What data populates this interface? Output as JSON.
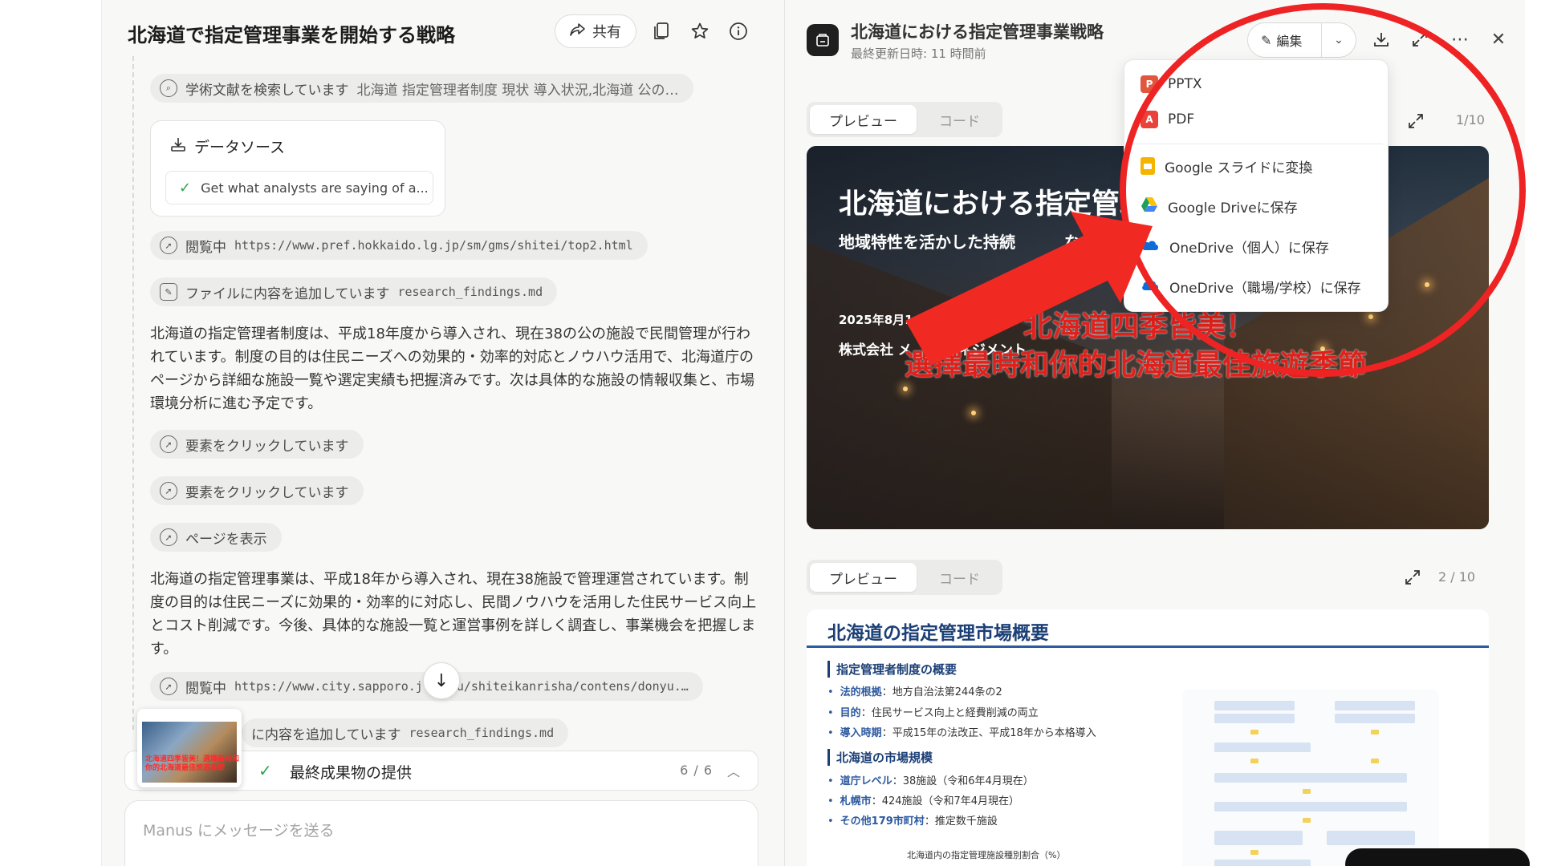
{
  "chat": {
    "title": "北海道で指定管理事業を開始する戦略",
    "share_label": "共有",
    "steps": {
      "search_academic": {
        "label": "学術文献を検索しています",
        "query": "北海道 指定管理者制度 現状 導入状況,北海道 公の…"
      },
      "browsing_1": {
        "label": "閲覧中",
        "url": "https://www.pref.hokkaido.lg.jp/sm/gms/shitei/top2.html"
      },
      "add_file_1": {
        "label": "ファイルに内容を追加しています",
        "file": "research_findings.md"
      },
      "click_1": {
        "label": "要素をクリックしています"
      },
      "click_2": {
        "label": "要素をクリックしています"
      },
      "view_page": {
        "label": "ページを表示"
      },
      "browsing_2": {
        "label": "閲覧中",
        "url_start": "https://www.city.sapporo.j",
        "url_end": "u/shiteikanrisha/contens/donyu.…"
      },
      "add_file_2": {
        "label": "に内容を追加しています",
        "file": "research_findings.md"
      }
    },
    "datasource": {
      "title": "データソース",
      "item": "Get what analysts are saying of a..."
    },
    "paragraph_1": "北海道の指定管理者制度は、平成18年度から導入され、現在38の公の施設で民間管理が行われています。制度の目的は住民ニーズへの効果的・効率的対応とノウハウ活用で、北海道庁のページから詳細な施設一覧や選定実績も把握済みです。次は具体的な施設の情報収集と、市場環境分析に進む予定です。",
    "paragraph_2": "北海道の指定管理事業は、平成18年から導入され、現在38施設で管理運営されています。制度の目的は住民ニーズに効果的・効率的に対応し、民間ノウハウを活用した住民サービス向上とコスト削減です。今後、具体的な施設一覧と運営事例を詳しく調査し、事業機会を把握します。",
    "progress": {
      "label": "最終成果物の提供",
      "count": "6 / 6"
    },
    "thumbnail_text": "北海道四季皆美！選擇最時和你的北海道最佳旅遊季節",
    "message_placeholder": "Manus にメッセージを送る"
  },
  "preview": {
    "title": "北海道における指定管理事業戦略",
    "subtitle": "最終更新日時: 11 時間前",
    "edit_label": "編集",
    "tab_preview": "プレビュー",
    "tab_code": "コード",
    "slide1_count": "1/10",
    "slide2_count": "2 / 10",
    "slide1": {
      "title": "北海道における指定管理事",
      "subtitle": "地域特性を活かした持続",
      "subtitle_tail": "な公共施",
      "date": "2025年8月1",
      "company": "株式会社 メ",
      "company_tail": "ンマネジメント",
      "watermark_line1": "北海道四季皆美！",
      "watermark_line2": "選擇最時和你的北海道最佳旅遊季節"
    },
    "slide2": {
      "title": "北海道の指定管理市場概要",
      "section1": "指定管理者制度の概要",
      "b1_key": "法的根拠",
      "b1_val": "：地方自治法第244条の2",
      "b2_key": "目的",
      "b2_val": "：住民サービス向上と経費削減の両立",
      "b3_key": "導入時期",
      "b3_val": "：平成15年の法改正、平成18年から本格導入",
      "section2": "北海道の市場規模",
      "b4_key": "道庁レベル",
      "b4_val": "：38施設（令和6年4月現在）",
      "b5_key": "札幌市",
      "b5_val": "：424施設（令和7年4月現在）",
      "b6_key": "その他179市町村",
      "b6_val": "：推定数千施設",
      "chart_caption": "北海道内の指定管理施設種別割合（%）"
    }
  },
  "export_menu": {
    "items": [
      "PPTX",
      "PDF",
      "Google スライドに変換",
      "Google Driveに保存",
      "OneDrive（個人）に保存",
      "OneDrive（職場/学校）に保存"
    ]
  },
  "colors": {
    "annotation_red": "#ee2323",
    "slide_heading_blue": "#1b3f76",
    "success_green": "#2da44e"
  }
}
